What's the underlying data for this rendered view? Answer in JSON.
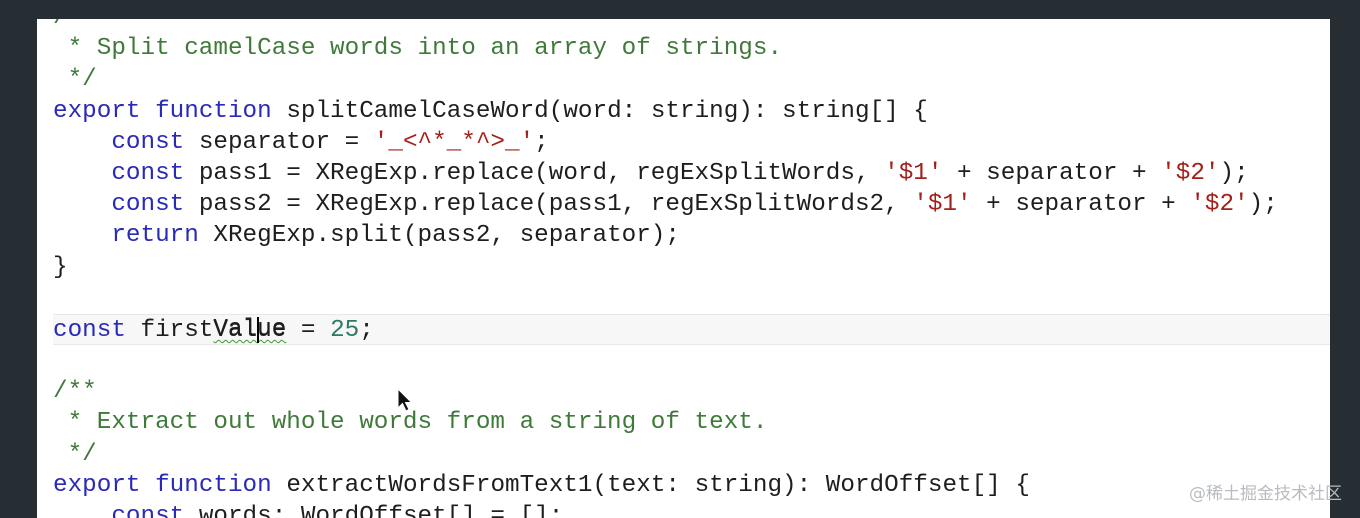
{
  "editor": {
    "language": "TypeScript",
    "colors": {
      "keyword": "#2a2ab8",
      "comment": "#3f7a3a",
      "string": "#a3201a",
      "number": "#2b7a66"
    },
    "current_line_index": 10,
    "cursor_after_text": "const firstVal",
    "squiggle_word": "Value",
    "lines": [
      [
        {
          "t": "/**",
          "c": "cm"
        }
      ],
      [
        {
          "t": " * Split camelCase words into an array of strings.",
          "c": "cm"
        }
      ],
      [
        {
          "t": " */",
          "c": "cm"
        }
      ],
      [
        {
          "t": "export",
          "c": "kw"
        },
        {
          "t": " ",
          "c": "id"
        },
        {
          "t": "function",
          "c": "kw"
        },
        {
          "t": " splitCamelCaseWord(word: string): string[] {",
          "c": "id"
        }
      ],
      [
        {
          "t": "    ",
          "c": "id"
        },
        {
          "t": "const",
          "c": "kw"
        },
        {
          "t": " separator = ",
          "c": "id"
        },
        {
          "t": "'_<^*_*^>_'",
          "c": "str"
        },
        {
          "t": ";",
          "c": "id"
        }
      ],
      [
        {
          "t": "    ",
          "c": "id"
        },
        {
          "t": "const",
          "c": "kw"
        },
        {
          "t": " pass1 = XRegExp.replace(word, regExSplitWords, ",
          "c": "id"
        },
        {
          "t": "'$1'",
          "c": "str"
        },
        {
          "t": " + separator + ",
          "c": "id"
        },
        {
          "t": "'$2'",
          "c": "str"
        },
        {
          "t": ");",
          "c": "id"
        }
      ],
      [
        {
          "t": "    ",
          "c": "id"
        },
        {
          "t": "const",
          "c": "kw"
        },
        {
          "t": " pass2 = XRegExp.replace(pass1, regExSplitWords2, ",
          "c": "id"
        },
        {
          "t": "'$1'",
          "c": "str"
        },
        {
          "t": " + separator + ",
          "c": "id"
        },
        {
          "t": "'$2'",
          "c": "str"
        },
        {
          "t": ");",
          "c": "id"
        }
      ],
      [
        {
          "t": "    ",
          "c": "id"
        },
        {
          "t": "return",
          "c": "kw"
        },
        {
          "t": " XRegExp.split(pass2, separator);",
          "c": "id"
        }
      ],
      [
        {
          "t": "}",
          "c": "id"
        }
      ],
      [],
      [
        {
          "t": "const",
          "c": "kw"
        },
        {
          "t": " firstVal",
          "c": "id"
        },
        {
          "t": "ue",
          "c": "id"
        },
        {
          "t": " = ",
          "c": "id"
        },
        {
          "t": "25",
          "c": "num"
        },
        {
          "t": ";",
          "c": "id"
        }
      ],
      [],
      [
        {
          "t": "/**",
          "c": "cm"
        }
      ],
      [
        {
          "t": " * Extract out whole words from a string of text.",
          "c": "cm"
        }
      ],
      [
        {
          "t": " */",
          "c": "cm"
        }
      ],
      [
        {
          "t": "export",
          "c": "kw"
        },
        {
          "t": " ",
          "c": "id"
        },
        {
          "t": "function",
          "c": "kw"
        },
        {
          "t": " extractWordsFromText1(text: string): WordOffset[] {",
          "c": "id"
        }
      ],
      [
        {
          "t": "    ",
          "c": "id"
        },
        {
          "t": "const",
          "c": "kw"
        },
        {
          "t": " words: WordOffset[] = [];",
          "c": "id"
        }
      ]
    ]
  },
  "watermark": "@稀土掘金技术社区"
}
